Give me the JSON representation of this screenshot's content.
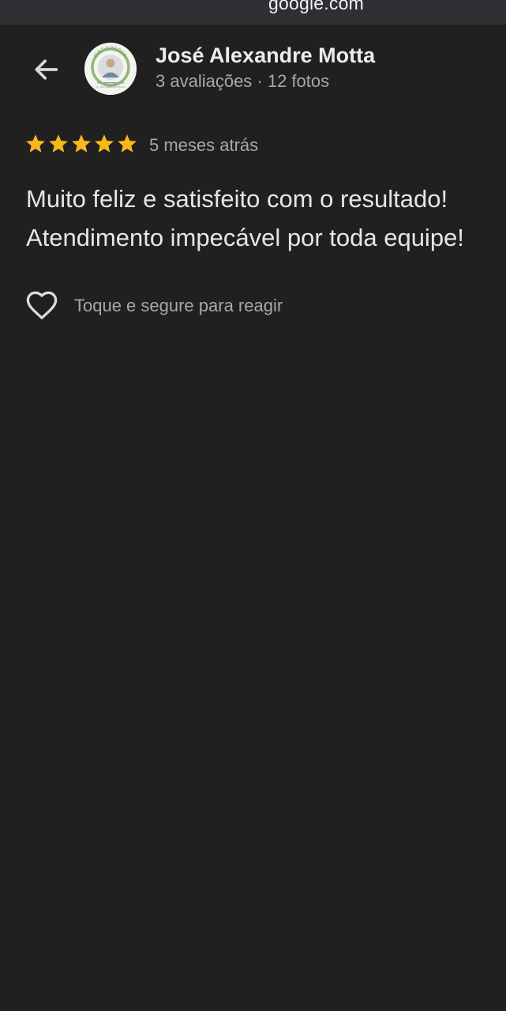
{
  "browser": {
    "url": "google.com"
  },
  "header": {
    "back_icon": "arrow-left-icon",
    "author_name": "José Alexandre Motta",
    "author_meta": "3 avaliações · 12 fotos",
    "avatar_badge_text": "ORTOPEDIA",
    "avatar_caption": "Dr. José Alexandre Motta"
  },
  "review": {
    "rating": 5,
    "rating_max": 5,
    "star_color": "#f8b81c",
    "date": "5 meses atrás",
    "text_line_1": "Muito feliz e satisfeito com o resultado!",
    "text_line_2": "Atendimento impecável por toda equipe!"
  },
  "reaction": {
    "icon": "heart-outline-icon",
    "label": "Toque e segure para reagir"
  }
}
